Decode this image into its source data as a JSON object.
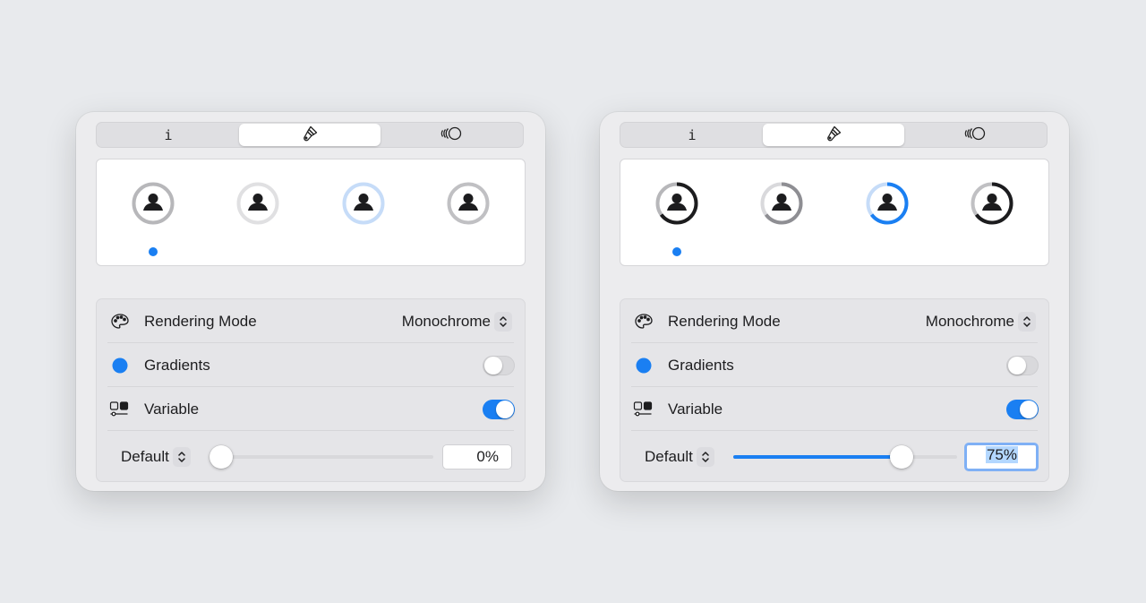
{
  "colors": {
    "accent": "#1a7ff2",
    "background": "#e8eaed"
  },
  "panels": [
    {
      "id": "left",
      "tabs": [
        {
          "label": "i",
          "icon": "info-icon"
        },
        {
          "label": "",
          "icon": "paintbrush-icon"
        },
        {
          "label": "",
          "icon": "variable-waves-icon"
        }
      ],
      "active_tab": 1,
      "variants": [
        "monochrome",
        "hierarchical",
        "palette",
        "multicolor"
      ],
      "selected_variant": 0,
      "settings": {
        "rendering_mode_label": "Rendering Mode",
        "rendering_mode_value": "Monochrome",
        "gradients_label": "Gradients",
        "gradients_on": false,
        "variable_label": "Variable",
        "variable_on": true,
        "default_label": "Default",
        "slider_value": 0,
        "percent_text": "0%"
      }
    },
    {
      "id": "right",
      "tabs": [
        {
          "label": "i",
          "icon": "info-icon"
        },
        {
          "label": "",
          "icon": "paintbrush-icon"
        },
        {
          "label": "",
          "icon": "variable-waves-icon"
        }
      ],
      "active_tab": 1,
      "variants": [
        "monochrome",
        "hierarchical",
        "palette",
        "multicolor"
      ],
      "selected_variant": 0,
      "settings": {
        "rendering_mode_label": "Rendering Mode",
        "rendering_mode_value": "Monochrome",
        "gradients_label": "Gradients",
        "gradients_on": false,
        "variable_label": "Variable",
        "variable_on": true,
        "default_label": "Default",
        "slider_value": 0.75,
        "percent_text": "75%"
      }
    }
  ]
}
